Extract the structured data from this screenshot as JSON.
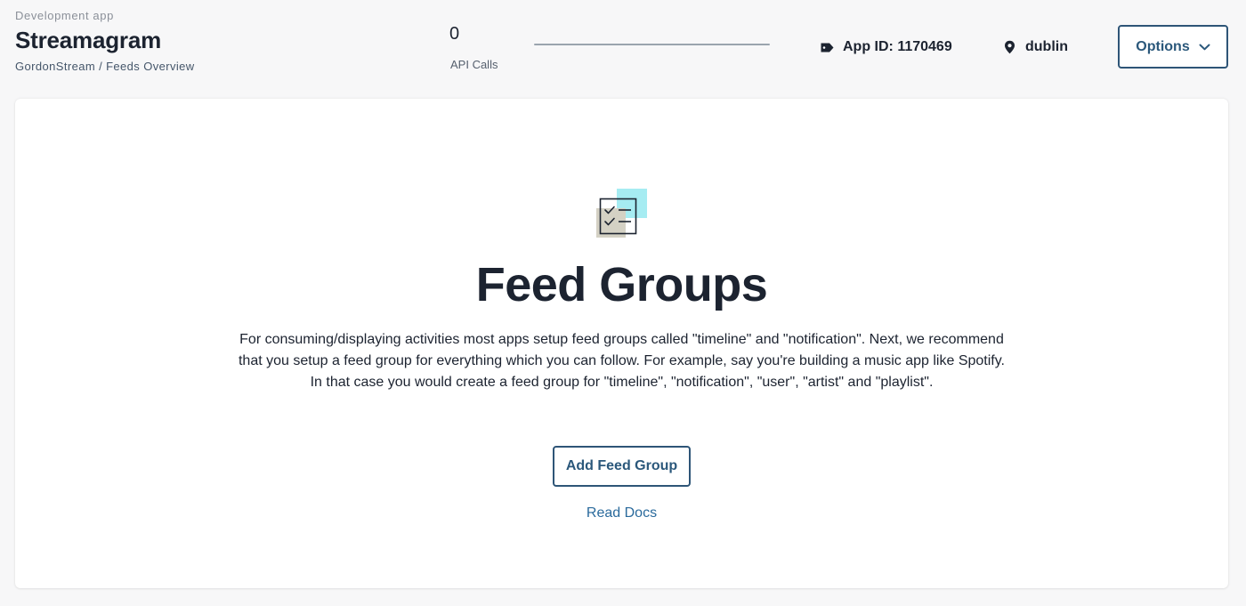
{
  "header": {
    "app_type": "Development app",
    "app_name": "Streamagram",
    "breadcrumb": {
      "org": "GordonStream",
      "separator": "/",
      "page": "Feeds Overview"
    },
    "api_calls": {
      "count": "0",
      "label": "API Calls",
      "usage_fraction": 0
    },
    "app_id": {
      "icon": "tag-icon",
      "text": "App ID: 1170469"
    },
    "region": {
      "icon": "map-pin-icon",
      "text": "dublin"
    },
    "options": {
      "label": "Options",
      "icon": "chevron-down-icon"
    }
  },
  "main": {
    "illustration_icon": "checklist-icon",
    "title": "Feed Groups",
    "description": "For consuming/displaying activities most apps setup feed groups called \"timeline\" and \"notification\". Next, we recommend that you setup a feed group for everything which you can follow. For example, say you're building a music app like Spotify. In that case you would create a feed group for \"timeline\", \"notification\", \"user\", \"artist\" and \"playlist\".",
    "add_button_label": "Add Feed Group",
    "docs_link_label": "Read Docs"
  },
  "colors": {
    "accent": "#2b587b",
    "link": "#2a6a9c",
    "text": "#1c2330",
    "illustration_cyan": "#a6ecf2",
    "illustration_beige": "#d4d1c4"
  }
}
